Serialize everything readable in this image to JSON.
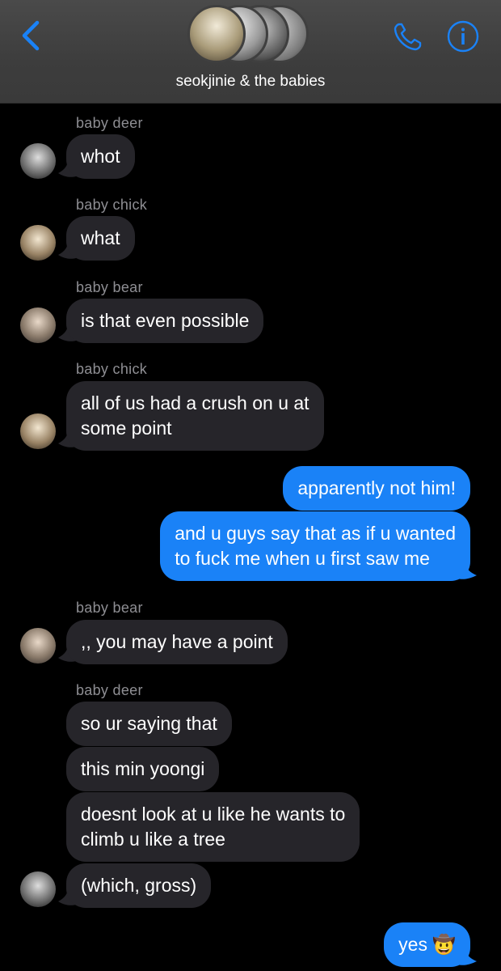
{
  "header": {
    "title": "seokjinie & the babies"
  },
  "messages": [
    {
      "sender": "baby deer",
      "text": "whot"
    },
    {
      "sender": "baby chick",
      "text": "what"
    },
    {
      "sender": "baby bear",
      "text": "is that even possible"
    },
    {
      "sender": "baby chick",
      "line1": "all of us had a crush on u at",
      "line2": "some point"
    },
    {
      "text": "apparently not him!"
    },
    {
      "line1": "and u guys say that as if u wanted",
      "line2": "to fuck me when u first saw me"
    },
    {
      "sender": "baby bear",
      "text": ",, you may have a point"
    },
    {
      "sender": "baby deer",
      "text": "so ur saying that"
    },
    {
      "text": "this min yoongi"
    },
    {
      "line1": "doesnt look at u like he wants to",
      "line2": "climb u like a tree"
    },
    {
      "text": "(which, gross)"
    },
    {
      "text": "yes",
      "emoji": "🤠"
    }
  ],
  "colors": {
    "accent": "#1a82f7",
    "incoming_bubble": "#26252a",
    "header_bg": "#3f3f3f",
    "sender_label": "#8e8e93"
  }
}
